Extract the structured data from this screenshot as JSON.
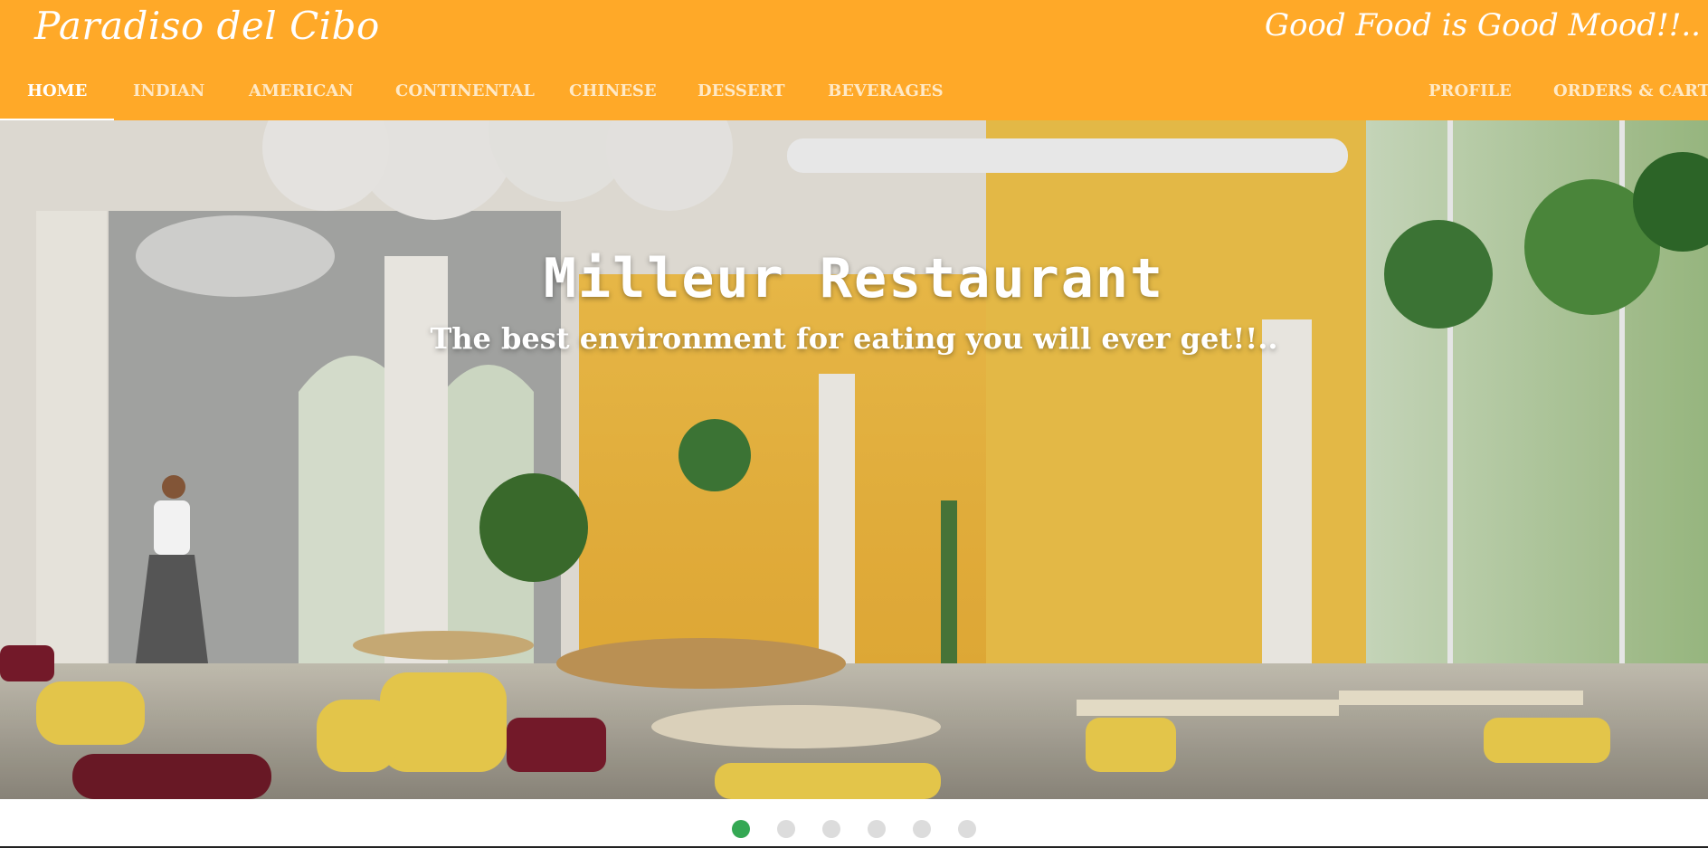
{
  "header": {
    "brand": "Paradiso del Cibo",
    "tagline": "Good Food is Good Mood!!..",
    "color": "#ffa928"
  },
  "nav": {
    "home": "HOME",
    "indian": "INDIAN",
    "american": "AMERICAN",
    "continental": "CONTINENTAL",
    "chinese": "CHINESE",
    "dessert": "DESSERT",
    "beverages": "BEVERAGES",
    "profile": "PROFILE",
    "orders_cart": "ORDERS & CART",
    "active": "HOME"
  },
  "hero": {
    "title": "Milleur Restaurant",
    "subtitle": "The best environment for eating you will ever get!!..",
    "image": "restaurant-interior-photo"
  },
  "carousel": {
    "slide_count": 6,
    "active_index": 0,
    "active_color": "#34a853",
    "inactive_color": "#dcdcdc"
  }
}
